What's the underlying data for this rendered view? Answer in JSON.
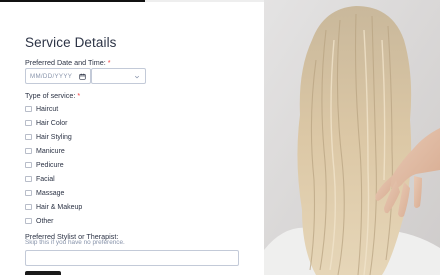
{
  "progress": {
    "fraction": 0.55,
    "fill_color": "#111111"
  },
  "section": {
    "title": "Service Details"
  },
  "date_field": {
    "label": "Preferred Date and Time:",
    "required_mark": "*",
    "date_placeholder": "MM/DD/YYYY",
    "time_value": ""
  },
  "service_field": {
    "label": "Type of service:",
    "required_mark": "*",
    "options": [
      "Haircut",
      "Hair Color",
      "Hair Styling",
      "Manicure",
      "Pedicure",
      "Facial",
      "Massage",
      "Hair & Makeup",
      "Other"
    ]
  },
  "stylist_field": {
    "label": "Preferred Stylist or Therapist:",
    "hint": "Skip this if you have no preference.",
    "value": ""
  },
  "colors": {
    "accent": "#1a1a1a",
    "required": "#f23a3c",
    "border": "#c3cad8"
  },
  "icons": {
    "date": "calendar-icon",
    "time": "chevron-down-icon"
  }
}
